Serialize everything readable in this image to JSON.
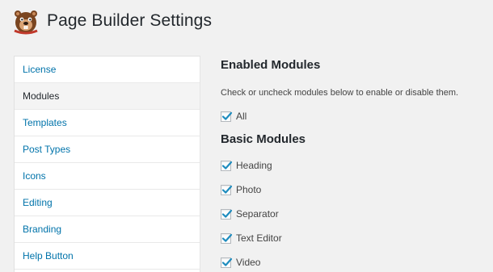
{
  "header": {
    "title": "Page Builder Settings",
    "logo_icon": "beaver-logo-icon"
  },
  "sidebar": {
    "items": [
      {
        "label": "License",
        "active": false
      },
      {
        "label": "Modules",
        "active": true
      },
      {
        "label": "Templates",
        "active": false
      },
      {
        "label": "Post Types",
        "active": false
      },
      {
        "label": "Icons",
        "active": false
      },
      {
        "label": "Editing",
        "active": false
      },
      {
        "label": "Branding",
        "active": false
      },
      {
        "label": "Help Button",
        "active": false
      }
    ]
  },
  "main": {
    "enabled_heading": "Enabled Modules",
    "description": "Check or uncheck modules below to enable or disable them.",
    "all_checkbox": {
      "label": "All",
      "checked": true
    },
    "basic_heading": "Basic Modules",
    "basic_modules": [
      {
        "label": "Heading",
        "checked": true
      },
      {
        "label": "Photo",
        "checked": true
      },
      {
        "label": "Separator",
        "checked": true
      },
      {
        "label": "Text Editor",
        "checked": true
      },
      {
        "label": "Video",
        "checked": true
      }
    ]
  },
  "colors": {
    "link": "#0073aa",
    "check": "#1e8cbe",
    "background": "#f1f1f1"
  }
}
